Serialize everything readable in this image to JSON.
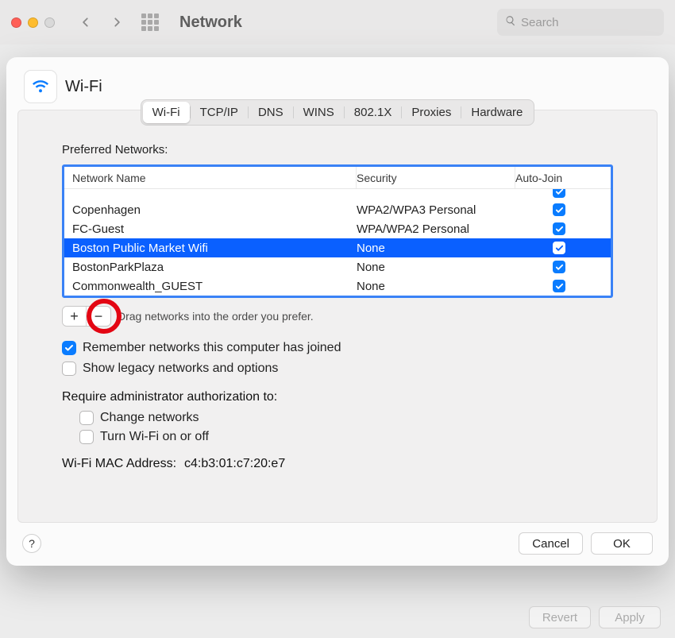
{
  "toolbar": {
    "title": "Network",
    "search_placeholder": "Search"
  },
  "modal": {
    "title": "Wi-Fi",
    "tabs": [
      "Wi-Fi",
      "TCP/IP",
      "DNS",
      "WINS",
      "802.1X",
      "Proxies",
      "Hardware"
    ],
    "active_tab": "Wi-Fi",
    "preferred_label": "Preferred Networks:",
    "columns": {
      "name": "Network Name",
      "security": "Security",
      "autojoin": "Auto-Join"
    },
    "networks": [
      {
        "name": "Copenhagen",
        "security": "WPA2/WPA3 Personal",
        "autojoin": true,
        "selected": false
      },
      {
        "name": "FC-Guest",
        "security": "WPA/WPA2 Personal",
        "autojoin": true,
        "selected": false
      },
      {
        "name": "Boston Public Market Wifi",
        "security": "None",
        "autojoin": true,
        "selected": true
      },
      {
        "name": "BostonParkPlaza",
        "security": "None",
        "autojoin": true,
        "selected": false
      },
      {
        "name": "Commonwealth_GUEST",
        "security": "None",
        "autojoin": true,
        "selected": false
      }
    ],
    "drag_hint": "Drag networks into the order you prefer.",
    "remember_label": "Remember networks this computer has joined",
    "remember_on": true,
    "legacy_label": "Show legacy networks and options",
    "legacy_on": false,
    "admin_label": "Require administrator authorization to:",
    "admin_opts": {
      "change_networks": {
        "label": "Change networks",
        "on": false
      },
      "toggle_wifi": {
        "label": "Turn Wi-Fi on or off",
        "on": false
      }
    },
    "mac_label": "Wi-Fi MAC Address:",
    "mac_value": "c4:b3:01:c7:20:e7",
    "buttons": {
      "help": "?",
      "cancel": "Cancel",
      "ok": "OK"
    },
    "pm": {
      "add": "+",
      "remove": "−"
    }
  },
  "page_footer": {
    "revert": "Revert",
    "apply": "Apply"
  }
}
